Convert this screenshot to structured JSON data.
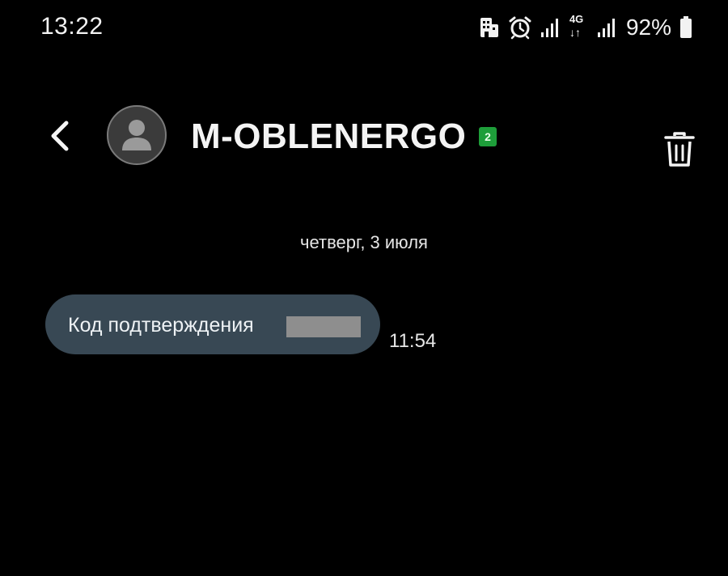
{
  "status_bar": {
    "time": "13:22",
    "battery_percent": "92%",
    "network_label": "4G",
    "network_arrows": "↓↑",
    "icons": [
      "hotel-icon",
      "alarm-icon",
      "signal-icon",
      "network-4g-icon",
      "signal-icon",
      "battery-icon"
    ]
  },
  "header": {
    "contact_name": "M-OBLENERGO",
    "sim_badge": "2",
    "icons": {
      "back": "back-arrow-icon",
      "avatar": "contact-avatar-icon",
      "delete": "trash-icon"
    }
  },
  "conversation": {
    "date_separator": "четверг, 3 июля",
    "messages": [
      {
        "text": "Код подтверждения",
        "code_redacted": true,
        "time": "11:54"
      }
    ]
  },
  "colors": {
    "background": "#000000",
    "bubble": "#384854",
    "sim_badge": "#1e9e3a",
    "redaction": "#8e8e8e"
  }
}
